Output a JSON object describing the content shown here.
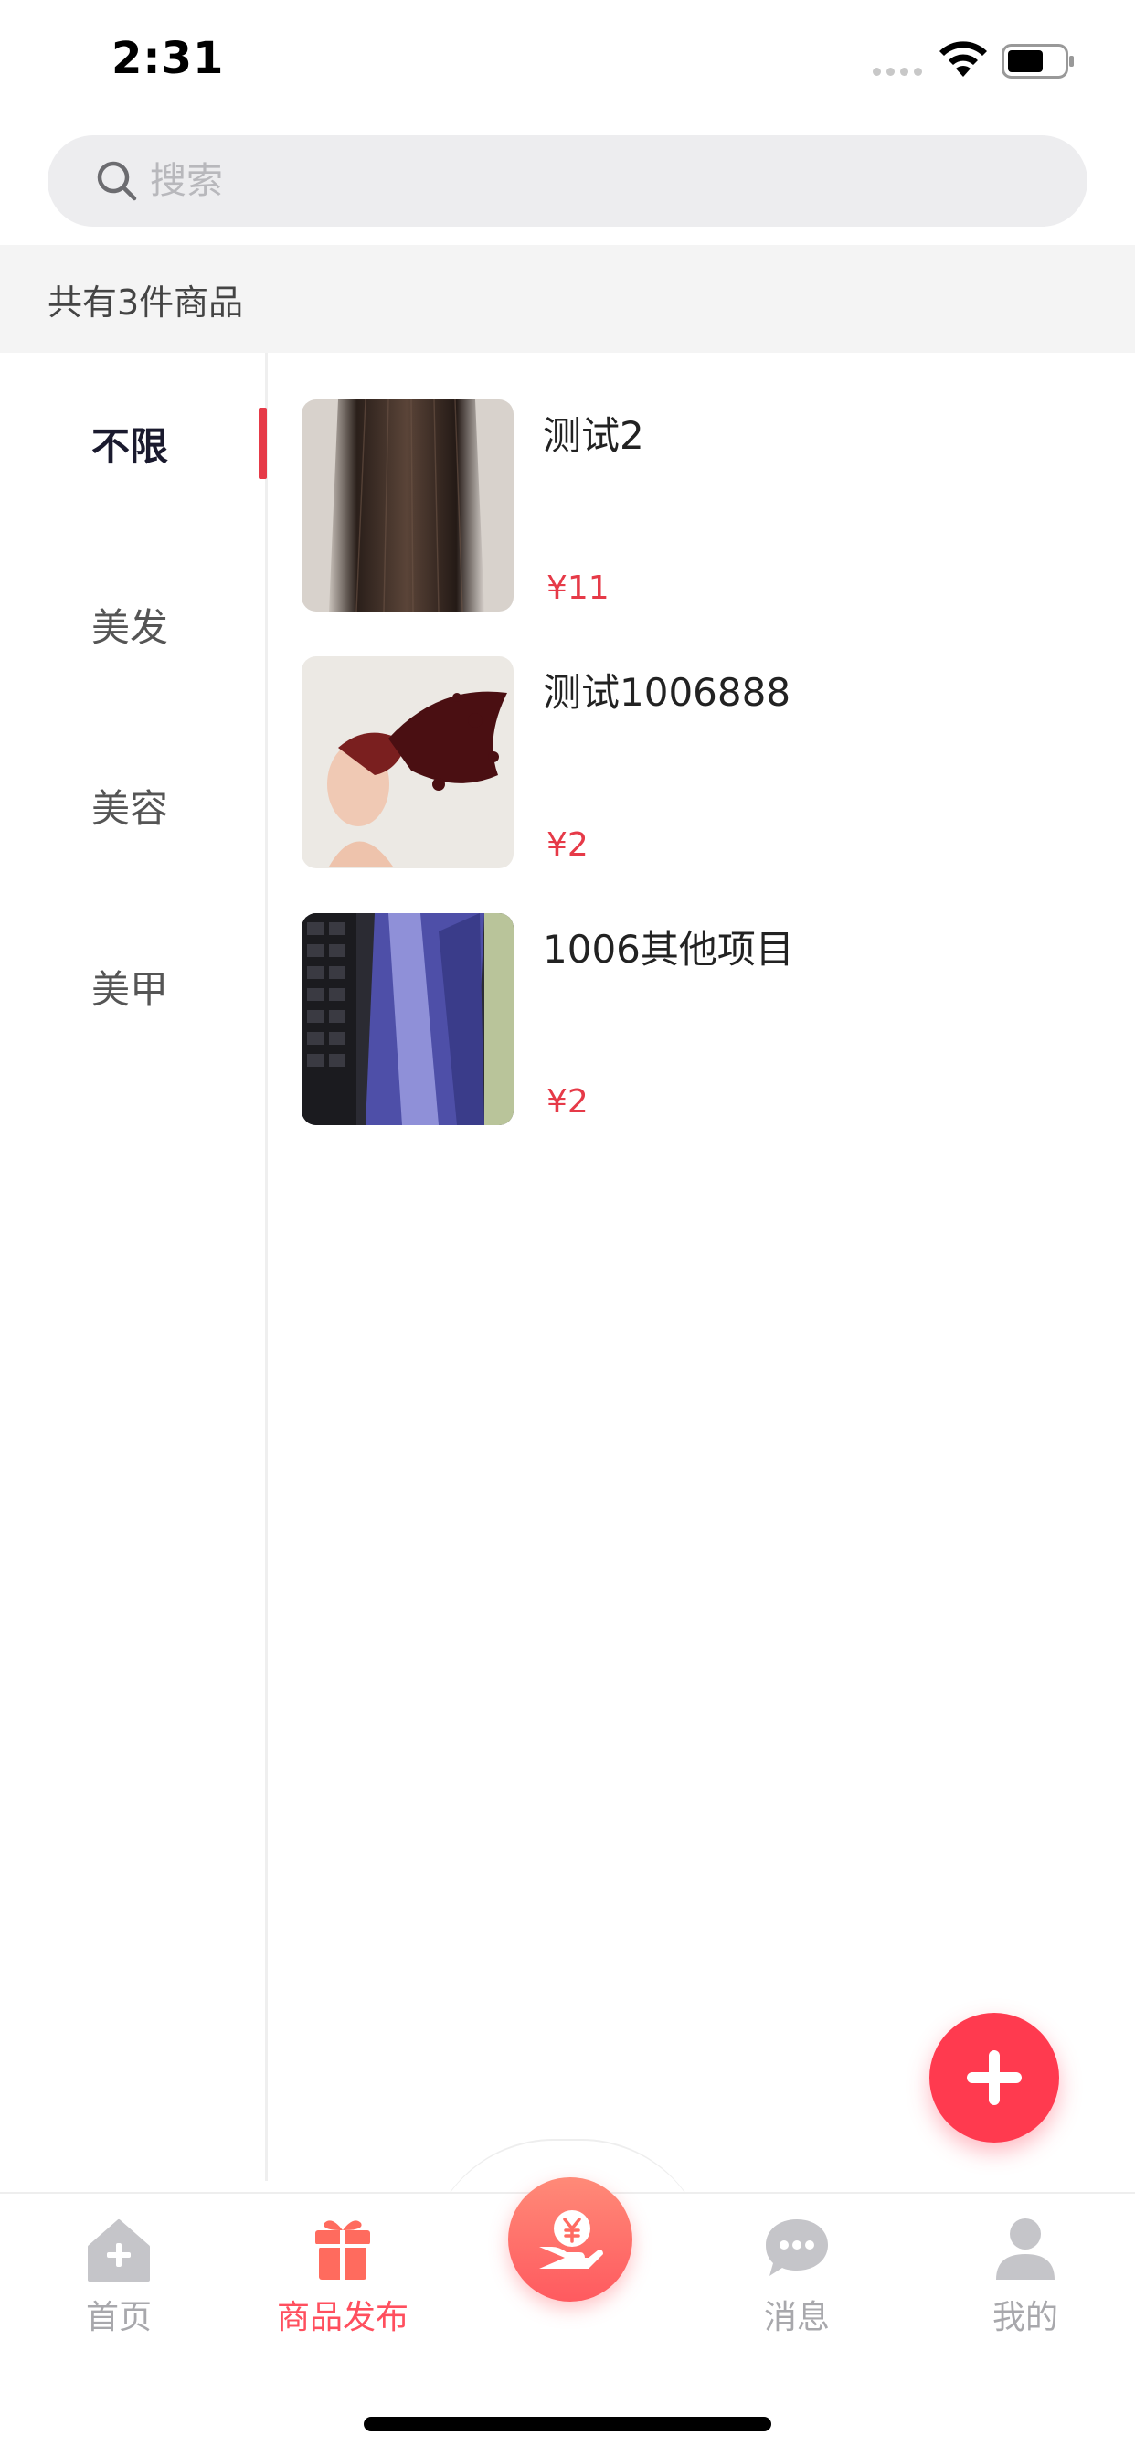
{
  "status_bar": {
    "time": "2:31"
  },
  "search": {
    "placeholder": "搜索",
    "value": ""
  },
  "summary": {
    "count_text": "共有3件商品"
  },
  "categories": [
    {
      "label": "不限",
      "active": true
    },
    {
      "label": "美发",
      "active": false
    },
    {
      "label": "美容",
      "active": false
    },
    {
      "label": "美甲",
      "active": false
    }
  ],
  "products": [
    {
      "title": "测试2",
      "price": "¥11"
    },
    {
      "title": "测试1006888",
      "price": "¥2"
    },
    {
      "title": "1006其他项目",
      "price": "¥2"
    }
  ],
  "tabbar": {
    "tabs": [
      {
        "label": "首页",
        "icon": "home-icon",
        "active": false
      },
      {
        "label": "商品发布",
        "icon": "gift-icon",
        "active": true
      },
      {
        "label": "消息",
        "icon": "chat-bubble-icon",
        "active": false
      },
      {
        "label": "我的",
        "icon": "user-icon",
        "active": false
      }
    ],
    "center_icon": "yuan-hand-icon"
  },
  "colors": {
    "accent": "#e63a48",
    "fab": "#ff3a4f",
    "tab_active": "#ff4f5e",
    "tab_inactive": "#a8a8ac"
  }
}
